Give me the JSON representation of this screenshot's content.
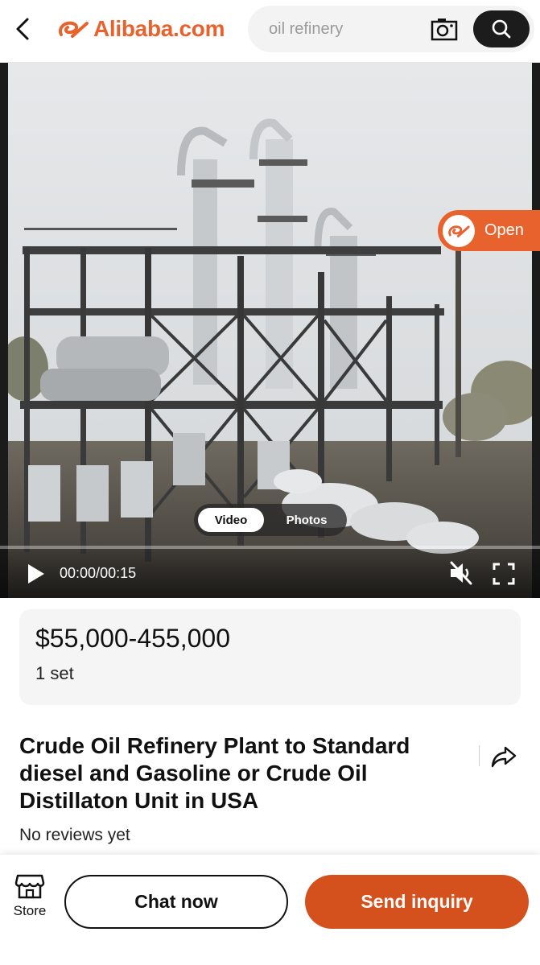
{
  "header": {
    "brand": "Alibaba.com",
    "search_placeholder": "oil refinery",
    "icons": [
      "back-arrow-icon",
      "alibaba-logo-icon",
      "camera-icon",
      "search-icon"
    ]
  },
  "media": {
    "open_label": "Open",
    "tabs": [
      {
        "label": "Video",
        "active": true
      },
      {
        "label": "Photos",
        "active": false
      }
    ],
    "time_current": "00:00",
    "time_separator": "/",
    "time_total": "00:15",
    "progress_fraction": 0,
    "muted": true
  },
  "product": {
    "price": "$55,000-455,000",
    "moq": "1 set",
    "title": "Crude Oil Refinery Plant to Standard diesel and Gasoline or Crude Oil Distillaton Unit in USA",
    "reviews": "No reviews yet"
  },
  "bottom_bar": {
    "store_label": "Store",
    "chat_label": "Chat now",
    "inquiry_label": "Send inquiry"
  },
  "colors": {
    "brand_orange": "#e8622d",
    "inquiry_button": "#d4511e",
    "search_button": "#1c1c1c"
  }
}
